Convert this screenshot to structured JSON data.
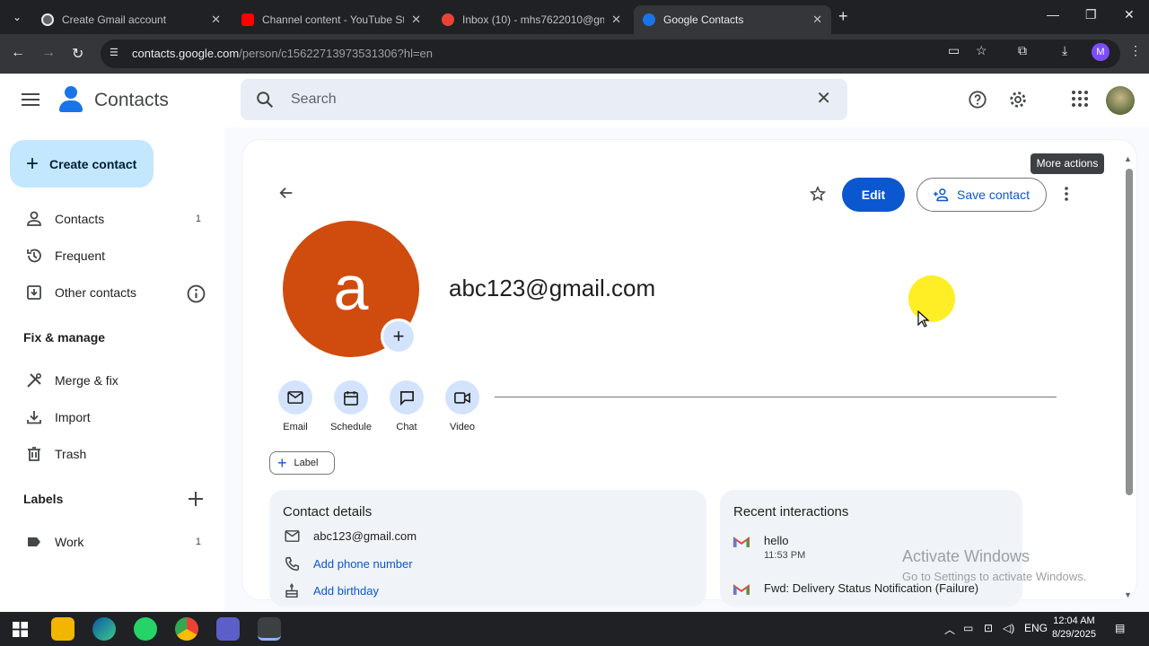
{
  "browser": {
    "tabs": [
      {
        "title": "Create Gmail account",
        "active": false
      },
      {
        "title": "Channel content - YouTube Stu",
        "active": false
      },
      {
        "title": "Inbox (10) - mhs7622010@gma",
        "active": false
      },
      {
        "title": "Google Contacts",
        "active": true
      }
    ],
    "url_domain": "contacts.google.com",
    "url_path": "/person/c1562271397353130​6?hl=en",
    "profile_initial": "M"
  },
  "header": {
    "app_name": "Contacts",
    "search_placeholder": "Search"
  },
  "sidebar": {
    "create_label": "Create contact",
    "items": [
      {
        "label": "Contacts",
        "count": "1"
      },
      {
        "label": "Frequent",
        "count": ""
      },
      {
        "label": "Other contacts",
        "count": ""
      }
    ],
    "fix_manage_heading": "Fix & manage",
    "fix_items": [
      {
        "label": "Merge & fix"
      },
      {
        "label": "Import"
      },
      {
        "label": "Trash"
      }
    ],
    "labels_heading": "Labels",
    "labels": [
      {
        "label": "Work",
        "count": "1"
      }
    ]
  },
  "contact": {
    "avatar_letter": "a",
    "avatar_color": "#d04b0e",
    "name": "abc123@gmail.com",
    "edit_label": "Edit",
    "save_label": "Save contact",
    "more_actions_tooltip": "More actions",
    "actions": [
      {
        "label": "Email"
      },
      {
        "label": "Schedule"
      },
      {
        "label": "Chat"
      },
      {
        "label": "Video"
      }
    ],
    "label_button": "Label",
    "details": {
      "title": "Contact details",
      "email": "abc123@gmail.com",
      "add_phone": "Add phone number",
      "add_birthday": "Add birthday"
    },
    "interactions": {
      "title": "Recent interactions",
      "items": [
        {
          "subject": "hello",
          "time": "11:53 PM"
        },
        {
          "subject": "Fwd: Delivery Status Notification (Failure)",
          "time": ""
        }
      ]
    }
  },
  "watermark": {
    "line1": "Activate Windows",
    "line2": "Go to Settings to activate Windows."
  },
  "taskbar": {
    "lang": "ENG",
    "time": "12:04 AM",
    "date": "8/29/2025"
  },
  "colors": {
    "accent": "#0b57d0",
    "create_btn_bg": "#c2e7ff",
    "action_circle_bg": "#d3e3fd"
  }
}
